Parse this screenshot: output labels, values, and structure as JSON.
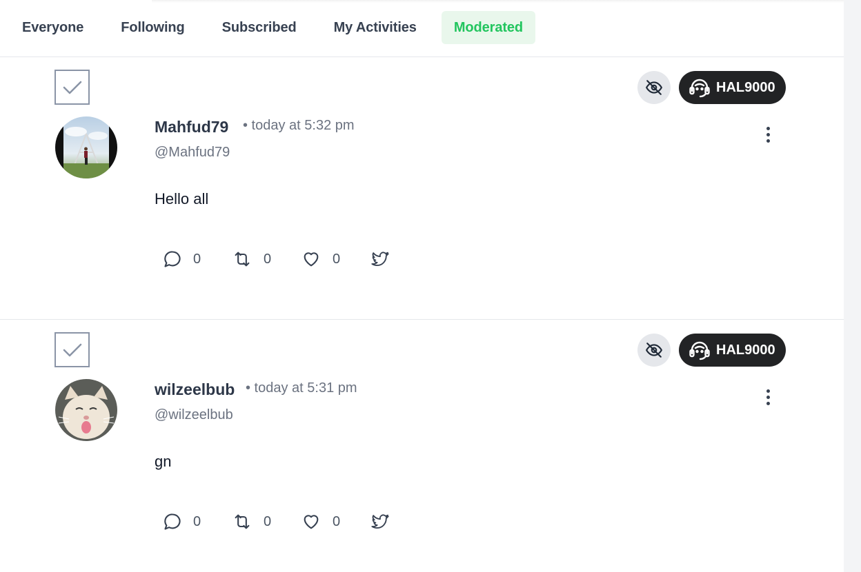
{
  "tabs": [
    {
      "label": "Everyone",
      "active": false
    },
    {
      "label": "Following",
      "active": false
    },
    {
      "label": "Subscribed",
      "active": false
    },
    {
      "label": "My Activities",
      "active": false
    },
    {
      "label": "Moderated",
      "active": true
    }
  ],
  "colors": {
    "accent": "#22c55e",
    "accent_bg": "#e9f7ec",
    "badge_bg": "#222325"
  },
  "posts": [
    {
      "author": "Mahfud79",
      "time": "• today at 5:32 pm",
      "handle": "@Mahfud79",
      "content": "Hello all",
      "moderator": "HAL9000",
      "replies": "0",
      "reposts": "0",
      "likes": "0",
      "avatar_icon": "avatar-photo-landscape"
    },
    {
      "author": "wilzeelbub",
      "time": "• today at 5:31 pm",
      "handle": "@wilzeelbub",
      "content": "gn",
      "moderator": "HAL9000",
      "replies": "0",
      "reposts": "0",
      "likes": "0",
      "avatar_icon": "avatar-photo-cat"
    }
  ]
}
